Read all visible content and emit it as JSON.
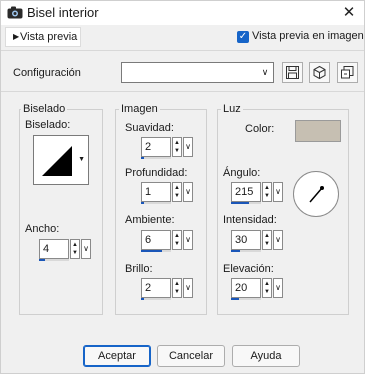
{
  "window": {
    "title": "Bisel interior",
    "close_glyph": "✕",
    "app_icon": "camera-icon"
  },
  "preview": {
    "toggle_label": "Vista previa",
    "toggle_arrow": "▶",
    "image_checkbox_label": "Vista previa en imagen",
    "image_checkbox_checked": true,
    "check_glyph": "✓"
  },
  "config": {
    "label": "Configuración",
    "value": "",
    "arrow": "∨",
    "icons": [
      "save-icon",
      "preset-cube-icon",
      "reset-icon"
    ]
  },
  "bevel": {
    "group_label": "Biselado",
    "shape_label": "Biselado:",
    "shape_drop_glyph": "▼",
    "width_label": "Ancho:",
    "width_value": "4",
    "width_fraction": 0.2
  },
  "image": {
    "group_label": "Imagen",
    "smoothness_label": "Suavidad:",
    "smoothness_value": "2",
    "smoothness_fraction": 0.1,
    "depth_label": "Profundidad:",
    "depth_value": "1",
    "depth_fraction": 0.1,
    "ambient_label": "Ambiente:",
    "ambient_value": "6",
    "ambient_fraction": 0.7,
    "brightness_label": "Brillo:",
    "brightness_value": "2",
    "brightness_fraction": 0.1
  },
  "light": {
    "group_label": "Luz",
    "color_label": "Color:",
    "color_value": "#c6bfb2",
    "angle_label": "Ángulo:",
    "angle_value": "215",
    "angle_fraction": 0.6,
    "intensity_label": "Intensidad:",
    "intensity_value": "30",
    "intensity_fraction": 0.3,
    "elevation_label": "Elevación:",
    "elevation_value": "20",
    "elevation_fraction": 0.25
  },
  "spin": {
    "up": "▲",
    "down": "▼",
    "drop": "∨"
  },
  "buttons": {
    "ok": "Aceptar",
    "cancel": "Cancelar",
    "help": "Ayuda"
  },
  "colors": {
    "accent": "#1664c8",
    "progress": "#1a56b8"
  }
}
